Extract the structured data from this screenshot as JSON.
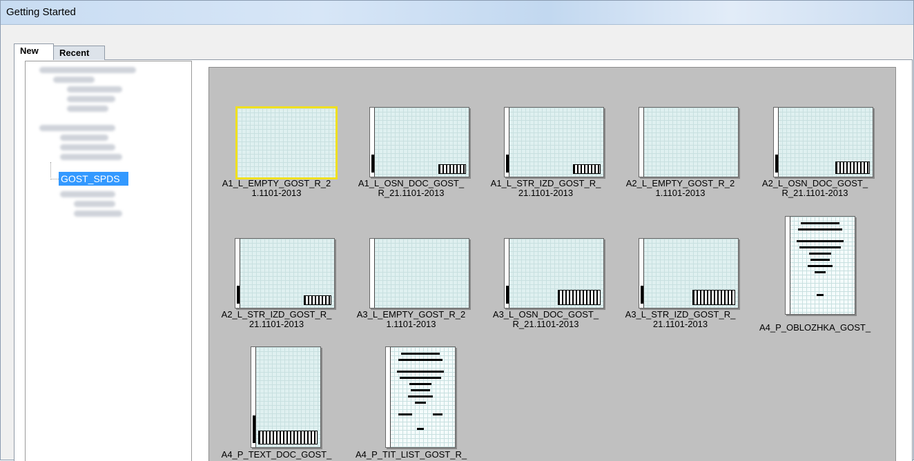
{
  "window": {
    "title": "Getting Started"
  },
  "tabs": {
    "new_label": "New",
    "recent_label": "Recent"
  },
  "tree": {
    "selected_item": "GOST_SPDS"
  },
  "templates": [
    {
      "label": "A1_L_EMPTY_GOST_R_2\n1.1101-2013",
      "orientation": "landscape",
      "selected": true
    },
    {
      "label": "A1_L_OSN_DOC_GOST_\nR_21.1101-2013",
      "orientation": "landscape"
    },
    {
      "label": "A1_L_STR_IZD_GOST_R_\n21.1101-2013",
      "orientation": "landscape"
    },
    {
      "label": "A2_L_EMPTY_GOST_R_2\n1.1101-2013",
      "orientation": "landscape"
    },
    {
      "label": "A2_L_OSN_DOC_GOST_\nR_21.1101-2013",
      "orientation": "landscape"
    },
    {
      "label": "A2_L_STR_IZD_GOST_R_\n21.1101-2013",
      "orientation": "landscape"
    },
    {
      "label": "A3_L_EMPTY_GOST_R_2\n1.1101-2013",
      "orientation": "landscape"
    },
    {
      "label": "A3_L_OSN_DOC_GOST_\nR_21.1101-2013",
      "orientation": "landscape"
    },
    {
      "label": "A3_L_STR_IZD_GOST_R_\n21.1101-2013",
      "orientation": "landscape"
    },
    {
      "label": "A4_P_OBLOZHKA_GOST_",
      "orientation": "portrait"
    },
    {
      "label": "A4_P_TEXT_DOC_GOST_",
      "orientation": "portrait"
    },
    {
      "label": "A4_P_TIT_LIST_GOST_R_",
      "orientation": "portrait"
    }
  ]
}
